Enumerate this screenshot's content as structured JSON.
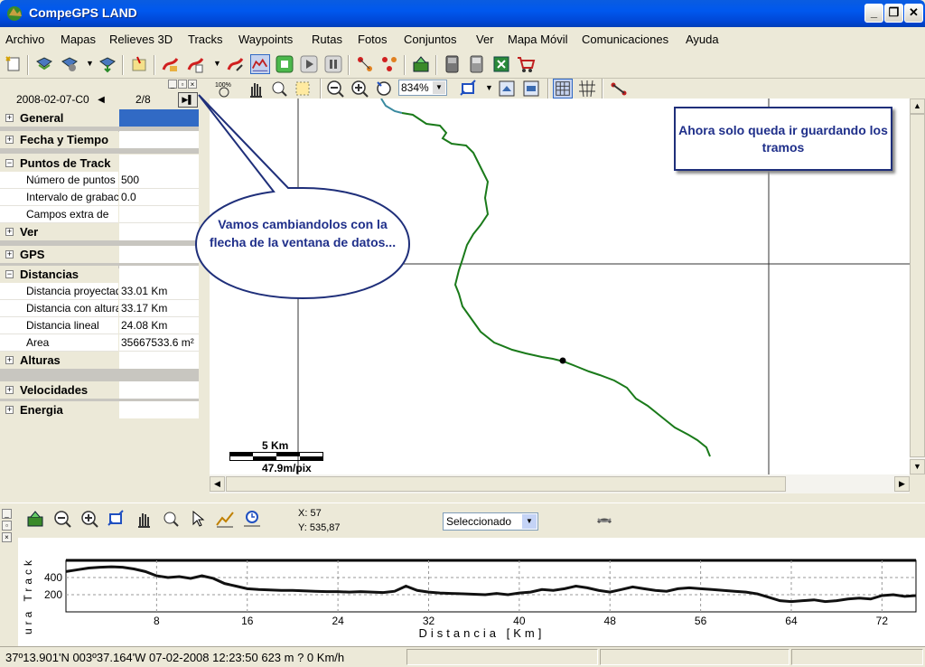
{
  "window": {
    "title": "CompeGPS LAND"
  },
  "menu": [
    "Archivo",
    "Mapas",
    "Relieves 3D",
    "Tracks",
    "Waypoints",
    "Rutas",
    "Fotos",
    "Conjuntos",
    "Ver",
    "Mapa Móvil",
    "Comunicaciones",
    "Ayuda"
  ],
  "toolbar_icons": [
    "new-icon",
    "open-map-icon",
    "map-settings-icon",
    "map-download-icon",
    "waypoint-icon",
    "track-open-icon",
    "track-new-icon",
    "track-edit-icon",
    "profile-chart-icon",
    "record-icon",
    "play-icon",
    "pause-icon",
    "route-icon",
    "route-edit-icon",
    "gps-device-icon",
    "gps-receive-icon",
    "gps-send-icon",
    "export-icon",
    "shop-icon"
  ],
  "panel": {
    "date_label": "2008-02-07-C0",
    "count": "2/8",
    "categories": {
      "general": "General",
      "fecha": "Fecha y Tiempo",
      "puntos": "Puntos de Track",
      "ver": "Ver",
      "gps": "GPS",
      "distancias": "Distancias",
      "alturas": "Alturas",
      "velocidades": "Velocidades",
      "energia": "Energia"
    },
    "puntos_rows": [
      {
        "label": "Número de puntos",
        "value": "500"
      },
      {
        "label": "Intervalo de grabación",
        "value": "0.0"
      },
      {
        "label": "Campos extra de",
        "value": ""
      }
    ],
    "distancias_rows": [
      {
        "label": "Distancia proyectada",
        "value": "33.01 Km"
      },
      {
        "label": "Distancia con altura",
        "value": "33.17 Km"
      },
      {
        "label": "Distancia lineal",
        "value": "24.08 Km"
      },
      {
        "label": "Area",
        "value": "35667533.6 m²"
      }
    ]
  },
  "map": {
    "zoom": "834%",
    "zoom_100_label": "100%",
    "note": "Ahora solo queda ir guardando los tramos",
    "bubble": "Vamos cambiandolos con la flecha de la ventana de datos...",
    "scale_km": "5 Km",
    "scale_px": "47.9m/pix",
    "track_color": "#1a7a1a"
  },
  "profile": {
    "coord_x": "X: 57",
    "coord_y": "Y: 535,87",
    "select_value": "Seleccionado",
    "y_axis_label": "ura Track",
    "x_axis_label": "Distancia [Km]"
  },
  "chart_data": {
    "type": "line",
    "xlabel": "Distancia [Km]",
    "ylabel": "ura Track",
    "xlim": [
      0,
      75
    ],
    "ylim": [
      0,
      600
    ],
    "xticks": [
      8,
      16,
      24,
      32,
      40,
      48,
      56,
      64,
      72
    ],
    "yticks": [
      200,
      400
    ],
    "series": [
      {
        "x": [
          0,
          1,
          2,
          3,
          4,
          5,
          6,
          7,
          8,
          9,
          10,
          11,
          12,
          13,
          14,
          15,
          16,
          17,
          18,
          19,
          20,
          21,
          22,
          23,
          24,
          25,
          26,
          27,
          28,
          29,
          30,
          31,
          32,
          33,
          34,
          35,
          36,
          37,
          38,
          39,
          40,
          41,
          42,
          43,
          44,
          45,
          46,
          47,
          48,
          49,
          50,
          51,
          52,
          53,
          54,
          55,
          56,
          57,
          58,
          59,
          60,
          61,
          62,
          63,
          64,
          65,
          66,
          67,
          68,
          69,
          70,
          71,
          72,
          73,
          74,
          75
        ],
        "values": [
          470,
          490,
          510,
          520,
          525,
          520,
          500,
          470,
          420,
          400,
          410,
          390,
          420,
          390,
          330,
          300,
          270,
          260,
          255,
          250,
          250,
          245,
          240,
          235,
          235,
          230,
          235,
          230,
          225,
          240,
          300,
          250,
          230,
          220,
          215,
          210,
          205,
          200,
          215,
          200,
          220,
          230,
          260,
          250,
          270,
          300,
          280,
          250,
          230,
          260,
          290,
          270,
          250,
          240,
          270,
          280,
          270,
          260,
          250,
          240,
          230,
          210,
          170,
          130,
          120,
          130,
          140,
          120,
          130,
          150,
          160,
          150,
          190,
          200,
          180,
          190
        ]
      }
    ]
  },
  "status": {
    "text": "37º13.901'N 003º37.164'W  07-02-2008  12:23:50  623 m  ?  0 Km/h"
  }
}
